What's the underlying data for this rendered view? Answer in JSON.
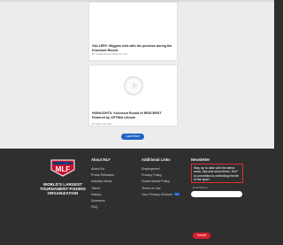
{
  "cards": [
    {
      "title": "GALLERY: Wiggins rolls with the punches during the Knockout Round",
      "meta": "BY Charlie Evans   About the Tour"
    },
    {
      "title": "HIGHLIGHTS: Knockout Round of REDCREST Powered by OPTIMA Lithium",
      "meta": "BY Major the Tour"
    }
  ],
  "load_more_label": "Load More",
  "footer": {
    "logo_text": "MLF",
    "tagline": "WORLD'S LARGEST TOURNAMENT-FISHING ORGANIZATION",
    "about": {
      "heading": "About MLF",
      "items": [
        "About Us",
        "Press Releases",
        "Industry News",
        "Talent",
        "History",
        "Sponsors",
        "FAQ"
      ]
    },
    "links": {
      "heading": "Additional Links",
      "items": [
        "Employment",
        "Privacy Policy",
        "Social Media Policy",
        "Terms of Use",
        "Your Privacy Choices"
      ]
    },
    "newsletter": {
      "heading": "Newsletter",
      "blurb": "Stay up to date with the latest news, tips and show times. MLF is committed to extending the life of the sport.",
      "field_caption": "Email Address",
      "email_placeholder": "",
      "submit_label": "Submit"
    }
  },
  "colors": {
    "accent_blue": "#1f63c7",
    "submit_red": "#d81f2a",
    "footer_bg": "#2f2f2f"
  }
}
